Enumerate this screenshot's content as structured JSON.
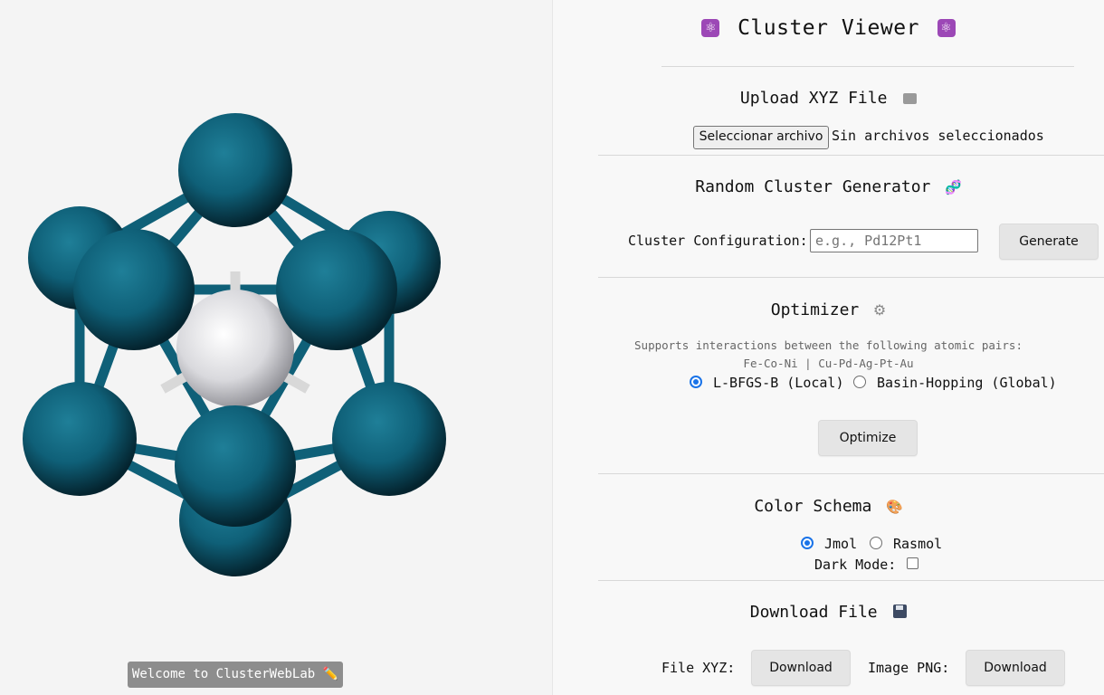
{
  "viewer": {
    "welcome": "Welcome to ClusterWebLab ✏️",
    "colors": {
      "atom": "#0f6078",
      "central_atom": "#e6e6ea",
      "bond": "#0f6078",
      "bond_light": "#d8d8d8"
    }
  },
  "panel": {
    "title": "Cluster Viewer",
    "upload": {
      "heading": "Upload XYZ File",
      "button": "Seleccionar archivo",
      "status": "Sin archivos seleccionados"
    },
    "generator": {
      "heading": "Random Cluster Generator",
      "config_label": "Cluster Configuration:",
      "placeholder": "e.g., Pd12Pt1",
      "generate_button": "Generate"
    },
    "optimizer": {
      "heading": "Optimizer",
      "note_line1": "Supports interactions between the following atomic pairs:",
      "note_line2": "Fe-Co-Ni | Cu-Pd-Ag-Pt-Au",
      "option_local": "L-BFGS-B (Local)",
      "option_global": "Basin-Hopping (Global)",
      "selected": "L-BFGS-B (Local)",
      "optimize_button": "Optimize"
    },
    "color_schema": {
      "heading": "Color Schema",
      "option_jmol": "Jmol",
      "option_rasmol": "Rasmol",
      "selected": "Jmol",
      "dark_mode_label": "Dark Mode:",
      "dark_mode": false
    },
    "download": {
      "heading": "Download File",
      "xyz_label": "File XYZ:",
      "xyz_button": "Download",
      "png_label": "Image PNG:",
      "png_button": "Download"
    }
  }
}
